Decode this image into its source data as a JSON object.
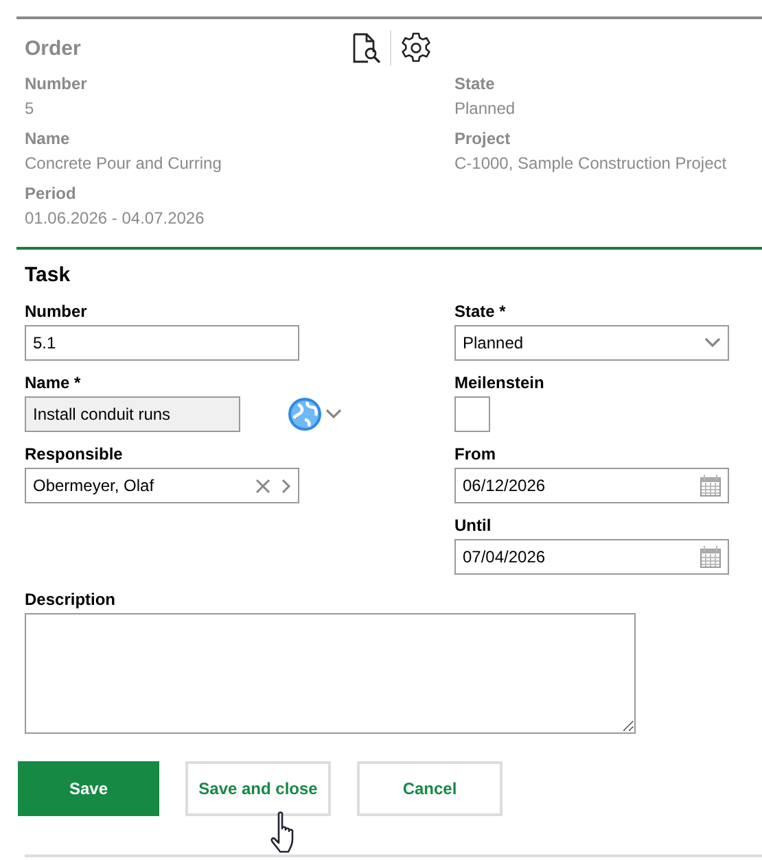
{
  "order": {
    "title": "Order",
    "fields": [
      {
        "label": "Number",
        "value": "5"
      },
      {
        "label": "State",
        "value": "Planned"
      },
      {
        "label": "Name",
        "value": "Concrete Pour and Curring"
      },
      {
        "label": "Project",
        "value": "C-1000, Sample Construction Project"
      },
      {
        "label": "Period",
        "value": "01.06.2026 - 04.07.2026"
      }
    ]
  },
  "task": {
    "title": "Task",
    "left": [
      {
        "kind": "text",
        "label": "Number",
        "value": "5.1",
        "disabled": false
      },
      {
        "kind": "translatable",
        "label": "Name *",
        "value": "Install conduit runs",
        "disabled": true
      },
      {
        "kind": "lookup",
        "label": "Responsible",
        "value": "Obermeyer, Olaf",
        "disabled": false
      }
    ],
    "right": [
      {
        "kind": "select",
        "label": "State *",
        "value": "Planned",
        "disabled": false
      },
      {
        "kind": "checkbox",
        "label": "Meilenstein",
        "checked": false,
        "disabled": false
      },
      {
        "kind": "date",
        "label": "From",
        "value": "06/12/2026",
        "disabled": false
      },
      {
        "kind": "date",
        "label": "Until",
        "value": "07/04/2026",
        "disabled": false
      }
    ],
    "description": {
      "label": "Description"
    }
  },
  "buttons": [
    {
      "kind": "primary",
      "label": "Save"
    },
    {
      "kind": "secondary",
      "label": "Save and close"
    },
    {
      "kind": "secondary",
      "label": "Cancel"
    }
  ]
}
